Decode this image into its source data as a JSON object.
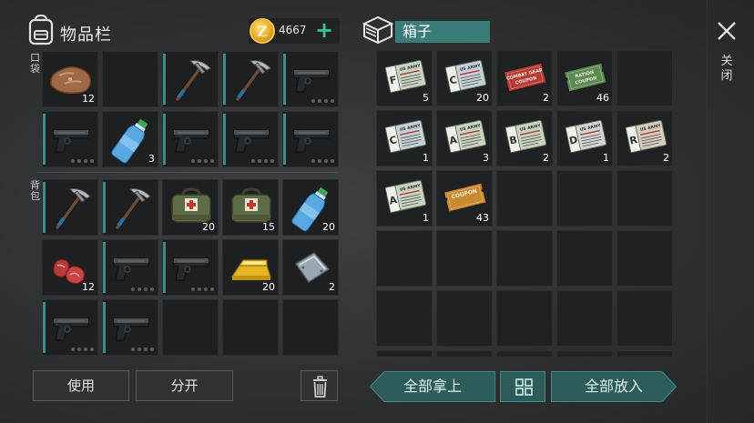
{
  "inventory": {
    "title": "物品栏",
    "coins": "4667",
    "coin_symbol": "Z",
    "pocket_label": "口袋",
    "backpack_label": "背包",
    "pocket_slots": [
      {
        "item": "stone",
        "count": "12"
      },
      {
        "item": "empty"
      },
      {
        "item": "pickaxe",
        "accent": true
      },
      {
        "item": "pickaxe",
        "accent": true
      },
      {
        "item": "pistol",
        "accent": true,
        "dots": true
      },
      {
        "item": "pistol",
        "accent": true,
        "dots": true
      },
      {
        "item": "water-bottle",
        "count": "3"
      },
      {
        "item": "pistol",
        "accent": true,
        "dots": true
      },
      {
        "item": "pistol",
        "accent": true,
        "dots": true
      },
      {
        "item": "pistol",
        "accent": true,
        "dots": true
      }
    ],
    "backpack_slots": [
      {
        "item": "pickaxe",
        "accent": true
      },
      {
        "item": "pickaxe",
        "accent": true
      },
      {
        "item": "medkit",
        "count": "20"
      },
      {
        "item": "medkit",
        "count": "15"
      },
      {
        "item": "water-bottle",
        "count": "20"
      },
      {
        "item": "raw-meat",
        "count": "12"
      },
      {
        "item": "pistol",
        "accent": true,
        "dots": true
      },
      {
        "item": "pistol",
        "accent": true,
        "dots": true
      },
      {
        "item": "gold-bar",
        "count": "20"
      },
      {
        "item": "steel-plate",
        "count": "2"
      },
      {
        "item": "pistol",
        "accent": true,
        "dots": true
      },
      {
        "item": "pistol",
        "accent": true,
        "dots": true
      },
      {
        "item": "empty"
      },
      {
        "item": "empty"
      },
      {
        "item": "empty"
      }
    ],
    "use_label": "使用",
    "split_label": "分开"
  },
  "box": {
    "title": "箱子",
    "close_label": "关闭",
    "slots": [
      {
        "item": "army-card",
        "letter": "F",
        "color": "#c8d4bf",
        "count": "5"
      },
      {
        "item": "army-card",
        "letter": "C",
        "color": "#c4d2d8",
        "count": "20"
      },
      {
        "item": "coupon",
        "text": "COMBAT GEAR\nCOUPON",
        "color": "#b83a36",
        "count": "2"
      },
      {
        "item": "coupon",
        "text": "RATION\nCOUPON",
        "color": "#5d8a50",
        "count": "46"
      },
      {
        "item": "empty"
      },
      {
        "item": "army-card",
        "letter": "C",
        "color": "#c4d2d8",
        "count": "1"
      },
      {
        "item": "army-card",
        "letter": "A",
        "color": "#c9d4be",
        "count": "3"
      },
      {
        "item": "army-card",
        "letter": "B",
        "color": "#c9d4be",
        "count": "2"
      },
      {
        "item": "army-card",
        "letter": "D",
        "color": "#d4d4d4",
        "count": "1"
      },
      {
        "item": "army-card",
        "letter": "R",
        "color": "#d4ccbd",
        "count": "2"
      },
      {
        "item": "army-card",
        "letter": "A",
        "color": "#c9d4be",
        "count": "1"
      },
      {
        "item": "coupon",
        "text": "COUPON",
        "color": "#c98a2f",
        "count": "43"
      }
    ],
    "take_all_label": "全部拿上",
    "put_all_label": "全部放入"
  },
  "colors": {
    "accent": "#3a8b8d",
    "teal_button": "#2d5c5b",
    "coin_gold": "#e6a823"
  }
}
